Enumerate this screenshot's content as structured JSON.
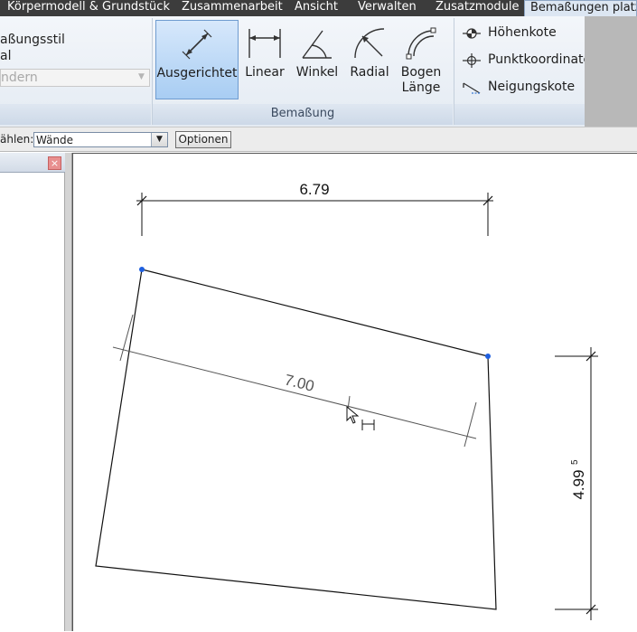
{
  "tabs": [
    {
      "label": "Körpermodell & Grundstück"
    },
    {
      "label": "Zusammenarbeit"
    },
    {
      "label": "Ansicht"
    },
    {
      "label": "Verwalten"
    },
    {
      "label": "Zusatzmodule"
    },
    {
      "label": "Bemaßungen platzi",
      "active": true
    }
  ],
  "left_panel": {
    "line1": "aßungsstil",
    "line2": "al",
    "dropdown_value": "ndern"
  },
  "dimension_panel": {
    "title": "Bemaßung",
    "buttons": [
      {
        "label": "Ausgerichtet",
        "icon": "aligned-dimension-icon",
        "active": true
      },
      {
        "label": "Linear",
        "icon": "linear-dimension-icon"
      },
      {
        "label": "Winkel",
        "icon": "angular-dimension-icon"
      },
      {
        "label": "Radial",
        "icon": "radial-dimension-icon"
      },
      {
        "label": "Bogen\nLänge",
        "label_line1": "Bogen",
        "label_line2": "Länge",
        "icon": "arc-length-dimension-icon"
      }
    ],
    "small_buttons": [
      {
        "label": "Höhenkote",
        "icon": "spot-elevation-icon"
      },
      {
        "label": "Punktkoordinate",
        "icon": "spot-coordinate-icon"
      },
      {
        "label": "Neigungskote",
        "icon": "spot-slope-icon"
      }
    ]
  },
  "options_bar": {
    "label": "ählen:",
    "select_value": "Wände",
    "button_label": "Optionen"
  },
  "palette": {
    "close_glyph": "×"
  },
  "drawing": {
    "dim_horizontal": "6.79",
    "dim_aligned": "7.00",
    "dim_vertical": "4.995",
    "dim_vertical_main": "4.99",
    "dim_vertical_super": "5",
    "vertex_color": "#1e5fe0"
  }
}
